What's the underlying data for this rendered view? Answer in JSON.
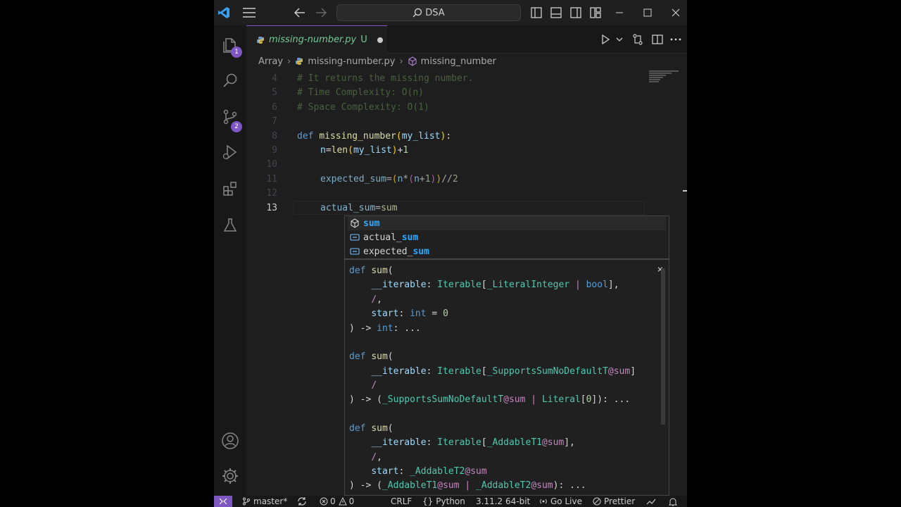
{
  "search": {
    "label": "DSA"
  },
  "activity": {
    "explorer_badge": "1",
    "scm_badge": "2"
  },
  "tab": {
    "filename": "missing-number.py",
    "status": "U"
  },
  "breadcrumb": {
    "folder": "Array",
    "file": "missing-number.py",
    "symbol": "missing_number"
  },
  "editor": {
    "line_numbers": [
      "4",
      "5",
      "6",
      "7",
      "8",
      "9",
      "10",
      "11",
      "12",
      "13"
    ],
    "lines": [
      "# It returns the missing number.",
      "# Time Complexity: O(n)",
      "# Space Complexity: O(1)",
      "",
      "def missing_number(my_list):",
      "n=len(my_list)+1",
      "",
      "expected_sum=(n*(n+1))//2",
      "",
      "actual_sum=sum"
    ]
  },
  "suggestions": [
    {
      "prefix": "",
      "match": "sum",
      "kind": "function-icon"
    },
    {
      "prefix": "actual_",
      "match": "sum",
      "kind": "variable-icon"
    },
    {
      "prefix": "expected_",
      "match": "sum",
      "kind": "variable-icon"
    }
  ],
  "details": {
    "lines": [
      "def sum(",
      "    __iterable: Iterable[_LiteralInteger | bool],",
      "    /,",
      "    start: int = 0",
      ") -> int: ...",
      "",
      "def sum(",
      "    __iterable: Iterable[_SupportsSumNoDefaultT@sum]",
      "    /",
      ") -> (_SupportsSumNoDefaultT@sum | Literal[0]): ...",
      "",
      "def sum(",
      "    __iterable: Iterable[_AddableT1@sum],",
      "    /,",
      "    start: _AddableT2@sum",
      ") -> (_AddableT1@sum | _AddableT2@sum): ..."
    ]
  },
  "status": {
    "branch": "master*",
    "errors": "0",
    "warnings": "0",
    "eol": "CRLF",
    "language": "Python",
    "interpreter": "3.11.2 64-bit",
    "golive": "Go Live",
    "prettier": "Prettier"
  },
  "colors": {
    "accent": "#7e57c2",
    "background": "#1e1e1e",
    "match": "#2aaaff"
  }
}
